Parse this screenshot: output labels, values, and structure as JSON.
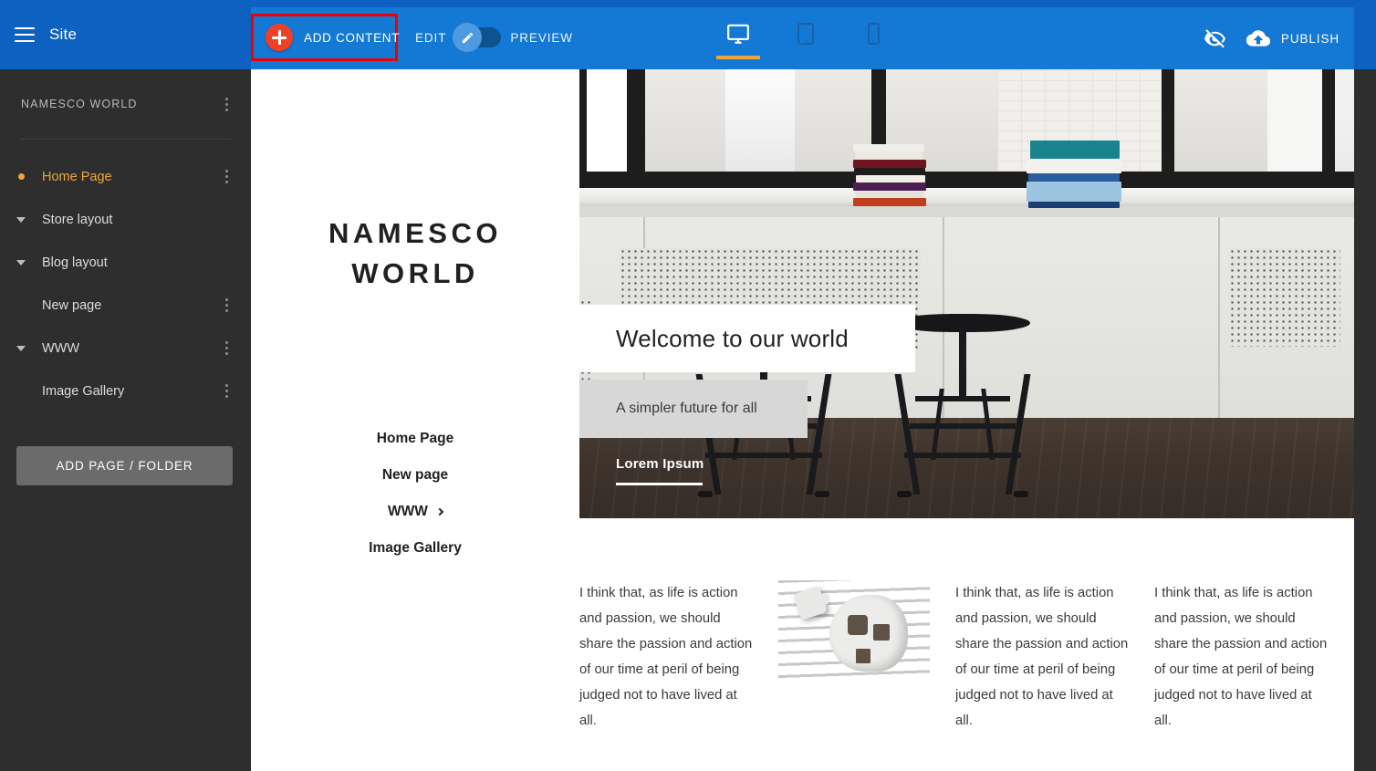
{
  "toolbar": {
    "menu_icon": "hamburger-icon",
    "site_label": "Site",
    "add_content_label": "ADD CONTENT",
    "add_content_icon": "plus-circle-icon",
    "highlight_color": "#ee0000",
    "edit_label": "EDIT",
    "preview_label": "PREVIEW",
    "toggle_icon": "pencil-icon",
    "toggle_state": "edit",
    "devices": [
      {
        "name": "desktop",
        "icon": "desktop-monitor-icon",
        "active": true
      },
      {
        "name": "tablet",
        "icon": "tablet-icon",
        "active": false
      },
      {
        "name": "mobile",
        "icon": "mobile-phone-icon",
        "active": false
      }
    ],
    "visibility_icon": "eye-off-icon",
    "publish_icon": "cloud-upload-icon",
    "publish_label": "PUBLISH",
    "accent_color": "#f0a53c",
    "bar_color": "#0d61c0",
    "panel_color": "#1479d5"
  },
  "sidebar": {
    "title": "NAMESCO WORLD",
    "title_menu_icon": "kebab-menu-icon",
    "add_page_label": "ADD PAGE / FOLDER",
    "background": "#2e2e2e",
    "items": [
      {
        "label": "Home Page",
        "marker": "dot",
        "active": true,
        "menu": true
      },
      {
        "label": "Store layout",
        "marker": "caret",
        "active": false,
        "menu": false
      },
      {
        "label": "Blog layout",
        "marker": "caret",
        "active": false,
        "menu": false
      },
      {
        "label": "New page",
        "marker": "none",
        "active": false,
        "menu": true
      },
      {
        "label": "WWW",
        "marker": "caret",
        "active": false,
        "menu": true
      },
      {
        "label": "Image Gallery",
        "marker": "none",
        "active": false,
        "menu": true
      }
    ]
  },
  "site": {
    "logo_line1": "NAMESCO",
    "logo_line2": "WORLD",
    "nav": [
      {
        "label": "Home Page",
        "has_chevron": false
      },
      {
        "label": "New page",
        "has_chevron": false
      },
      {
        "label": "WWW",
        "has_chevron": true
      },
      {
        "label": "Image Gallery",
        "has_chevron": false
      }
    ],
    "hero": {
      "title": "Welcome to our world",
      "subtitle": "A simpler future for all",
      "kicker": "Lorem Ipsum",
      "image_alt": "two black stools by a window with books on the sill"
    },
    "columns": [
      {
        "type": "text",
        "text": "I think that, as life is action and passion, we should share the passion and action of our time at peril of being judged not to have lived at all."
      },
      {
        "type": "image",
        "image_alt": "paper puzzle head on wooden background"
      },
      {
        "type": "text",
        "text": "I think that, as life is action and passion, we should share the passion and action of our time at peril of being judged not to have lived at all."
      },
      {
        "type": "text",
        "text": "I think that, as life is action and passion, we should share the passion and action of our time at peril of being judged not to have lived at all."
      }
    ]
  }
}
